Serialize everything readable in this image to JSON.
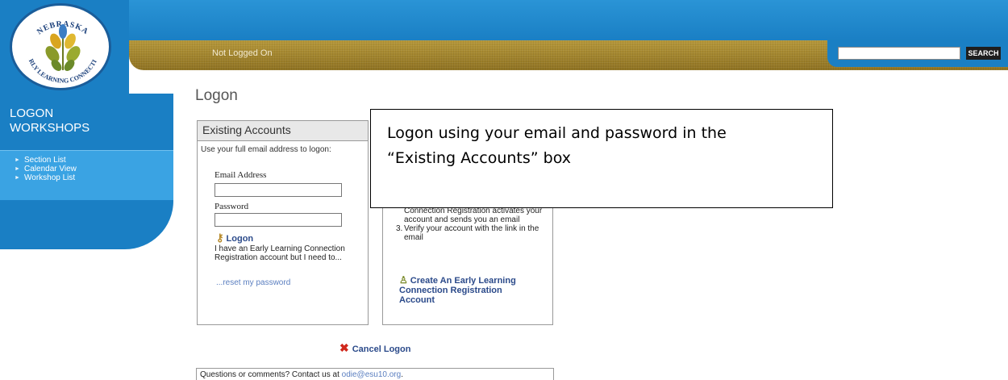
{
  "logo": {
    "alt_text": "NEBRASKA EARLY LEARNING CONNECTION",
    "top_arc": "NEBRASKA",
    "bottom_arc": "EARLY LEARNING CONNECTION"
  },
  "header": {
    "status": "Not Logged On",
    "search_placeholder": "",
    "search_button": "SEARCH"
  },
  "sidebar": {
    "title_line1": "LOGON",
    "title_line2": "WORKSHOPS",
    "items": [
      {
        "label": "Section List"
      },
      {
        "label": "Calendar View"
      },
      {
        "label": "Workshop List"
      }
    ]
  },
  "page": {
    "title": "Logon"
  },
  "existing": {
    "header": "Existing Accounts",
    "hint": "Use your full email address to logon:",
    "email_label": "Email Address",
    "password_label": "Password",
    "logon_label": "Logon",
    "account_text": "I have an Early Learning Connection Registration account but I need to...",
    "reset_label": "...reset my password"
  },
  "new_account": {
    "steps": [
      {
        "num": "",
        "text": "Connection Registration activates your account and sends you an email"
      },
      {
        "num": "3.",
        "text": "Verify your account with the link in the email"
      }
    ],
    "create_label": "Create An Early Learning Connection Registration Account"
  },
  "callout": {
    "line1": "Logon using your email and password in the",
    "line2": "“Existing Accounts” box"
  },
  "cancel": {
    "label": "Cancel Logon"
  },
  "footer": {
    "text": "Questions or comments? Contact us at ",
    "email": "odie@esu10.org",
    "suffix": "."
  },
  "colors": {
    "header_blue": "#1a7fc4",
    "gold": "#a88a2e",
    "link": "#2b4a8a",
    "cancel": "#d0281c"
  }
}
